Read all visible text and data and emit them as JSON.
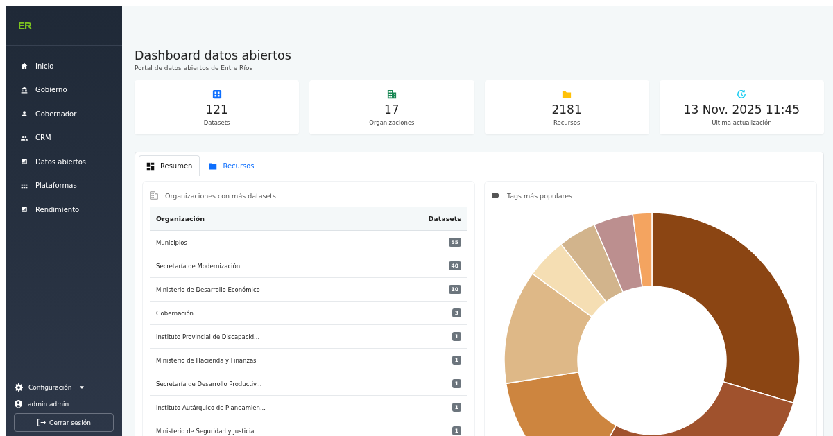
{
  "sidebar": {
    "logo": "ER",
    "items": [
      {
        "label": "Inicio",
        "kind": "home"
      },
      {
        "label": "Gobierno",
        "kind": "bank"
      },
      {
        "label": "Gobernador",
        "kind": "person"
      },
      {
        "label": "CRM",
        "kind": "people"
      },
      {
        "label": "Datos abiertos",
        "kind": "chart"
      },
      {
        "label": "Plataformas",
        "kind": "grid"
      },
      {
        "label": "Rendimiento",
        "kind": "chart"
      }
    ],
    "settings": "Configuración",
    "user": "admin admin",
    "logout": "Cerrar sesión"
  },
  "header": {
    "title": "Dashboard datos abiertos",
    "subtitle": "Portal de datos abiertos de Entre Ríos"
  },
  "stats": [
    {
      "kind": "grid",
      "value": "121",
      "label": "Datasets"
    },
    {
      "kind": "building",
      "value": "17",
      "label": "Organizaciones"
    },
    {
      "kind": "folder",
      "value": "2181",
      "label": "Recursos"
    },
    {
      "kind": "clock",
      "value": "13 Nov. 2025 11:45",
      "label": "Última actualización"
    }
  ],
  "tabs": [
    {
      "label": "Resumen",
      "kind": "dashboard",
      "selected": true
    },
    {
      "label": "Recursos",
      "kind": "folder",
      "selected": false
    }
  ],
  "organizations": {
    "title": "Organizaciones con más datasets",
    "columns": [
      "Organización",
      "Datasets"
    ],
    "rows": [
      [
        "Municipios",
        "55"
      ],
      [
        "Secretaría de Modernización",
        "40"
      ],
      [
        "Ministerio de Desarrollo Económico",
        "10"
      ],
      [
        "Gobernación",
        "3"
      ],
      [
        "Instituto Provincial de Discapacid...",
        "1"
      ],
      [
        "Ministerio de Hacienda y Finanzas",
        "1"
      ],
      [
        "Secretaría de Desarrollo Productiv...",
        "1"
      ],
      [
        "Instituto Autárquico de Planeamien...",
        "1"
      ],
      [
        "Ministerio de Seguridad y Justicia",
        "1"
      ]
    ]
  },
  "tags": {
    "title": "Tags más populares"
  }
}
